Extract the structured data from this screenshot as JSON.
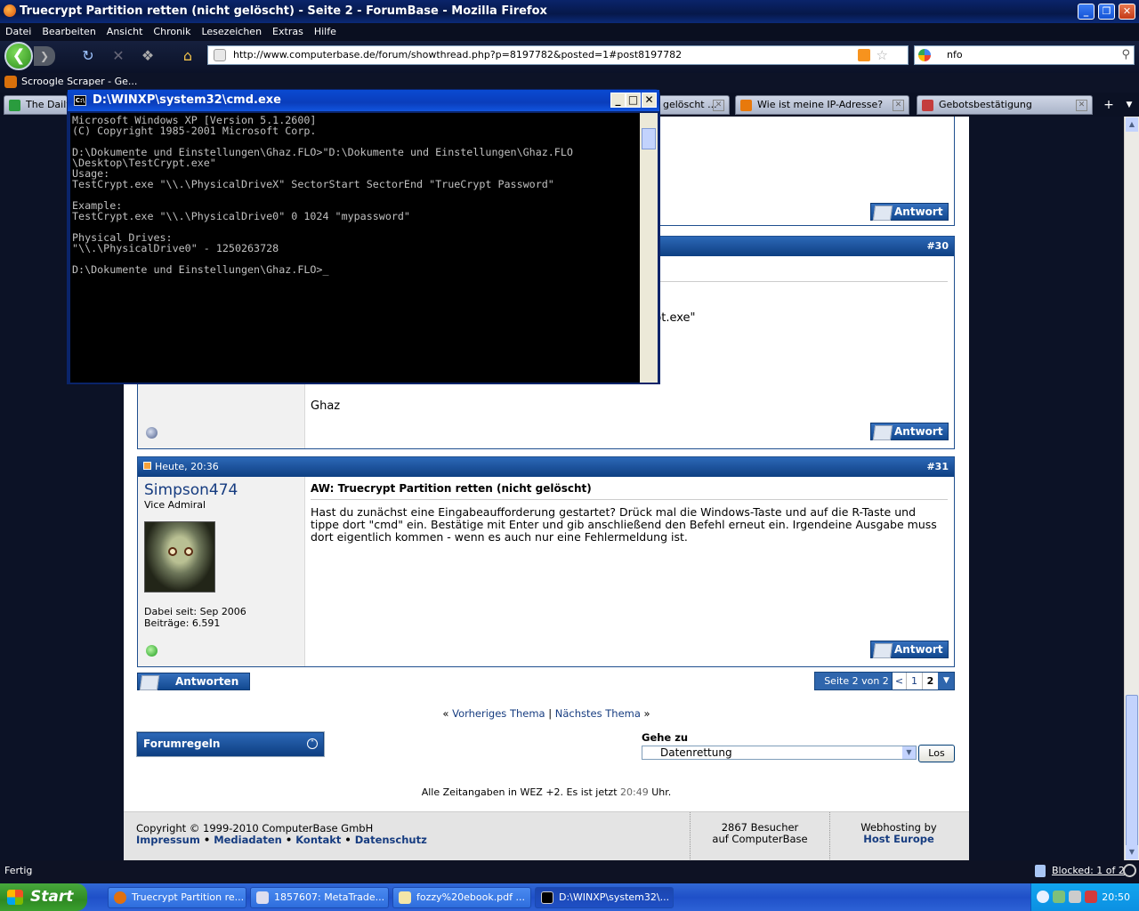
{
  "browser": {
    "window_title": "Truecrypt Partition retten (nicht gelöscht) - Seite 2 - ForumBase - Mozilla Firefox",
    "menu": [
      "Datei",
      "Bearbeiten",
      "Ansicht",
      "Chronik",
      "Lesezeichen",
      "Extras",
      "Hilfe"
    ],
    "url": "http://www.computerbase.de/forum/showthread.php?p=8197782&posted=1#post8197782",
    "search_value": "nfo",
    "bookmark": "Scroogle Scraper - Ge...",
    "tabs": [
      {
        "label": "The Daily"
      },
      {
        "label": "gelöscht ..."
      },
      {
        "label": "Wie ist meine IP-Adresse?"
      },
      {
        "label": "Gebotsbestätigung"
      }
    ],
    "status": "Fertig",
    "blocked": "Blocked: 1 of 2"
  },
  "cmd": {
    "title": "D:\\WINXP\\system32\\cmd.exe",
    "lines": [
      "Microsoft Windows XP [Version 5.1.2600]",
      "(C) Copyright 1985-2001 Microsoft Corp.",
      "",
      "D:\\Dokumente und Einstellungen\\Ghaz.FLO>\"D:\\Dokumente und Einstellungen\\Ghaz.FLO",
      "\\Desktop\\TestCrypt.exe\"",
      "Usage:",
      "TestCrypt.exe \"\\\\.\\PhysicalDriveX\" SectorStart SectorEnd \"TrueCrypt Password\"",
      "",
      "Example:",
      "TestCrypt.exe \"\\\\.\\PhysicalDrive0\" 0 1024 \"mypassword\"",
      "",
      "Physical Drives:",
      "\"\\\\.\\PhysicalDrive0\" - 1250263728",
      "",
      "D:\\Dokumente und Einstellungen\\Ghaz.FLO>_"
    ]
  },
  "forum": {
    "antwort_label": "Antwort",
    "post30": {
      "num": "#30",
      "snippet": "pt.exe\"",
      "body_end": "Ghaz"
    },
    "post31": {
      "date": "Heute, 20:36",
      "num": "#31",
      "user": "Simpson474",
      "rank": "Vice Admiral",
      "since": "Dabei seit: Sep 2006",
      "posts": "Beiträge: 6.591",
      "title": "AW: Truecrypt Partition retten (nicht gelöscht)",
      "body": "Hast du zunächst eine Eingabeaufforderung gestartet? Drück mal die Windows-Taste und auf die R-Taste und tippe dort \"cmd\" ein. Bestätige mit Enter und gib anschließend den Befehl erneut ein. Irgendeine Ausgabe muss dort eigentlich kommen - wenn es auch nur eine Fehlermeldung ist."
    },
    "antworten_label": "Antworten",
    "pager": {
      "label": "Seite 2 von 2",
      "prev": "<",
      "p1": "1",
      "p2": "2"
    },
    "prev_thread": "Vorheriges Thema",
    "next_thread": "Nächstes Thema",
    "sep": "|",
    "forumregeln": "Forumregeln",
    "goto_label": "Gehe zu",
    "goto_value": "Datenrettung",
    "goto_button": "Los",
    "time_text_a": "Alle Zeitangaben in WEZ +2. Es ist jetzt",
    "time_value": "20:49",
    "time_text_b": "Uhr.",
    "copyright": "Copyright © 1999-2010 ComputerBase GmbH",
    "footer_links": [
      "Impressum",
      "Mediadaten",
      "Kontakt",
      "Datenschutz"
    ],
    "visitors_a": "2867 Besucher",
    "visitors_b": "auf ComputerBase",
    "hosting_a": "Webhosting by",
    "hosting_b": "Host Europe"
  },
  "taskbar": {
    "start": "Start",
    "tasks": [
      "Truecrypt Partition re...",
      "1857607: MetaTrade...",
      "fozzy%20ebook.pdf ...",
      "D:\\WINXP\\system32\\..."
    ],
    "clock": "20:50"
  }
}
